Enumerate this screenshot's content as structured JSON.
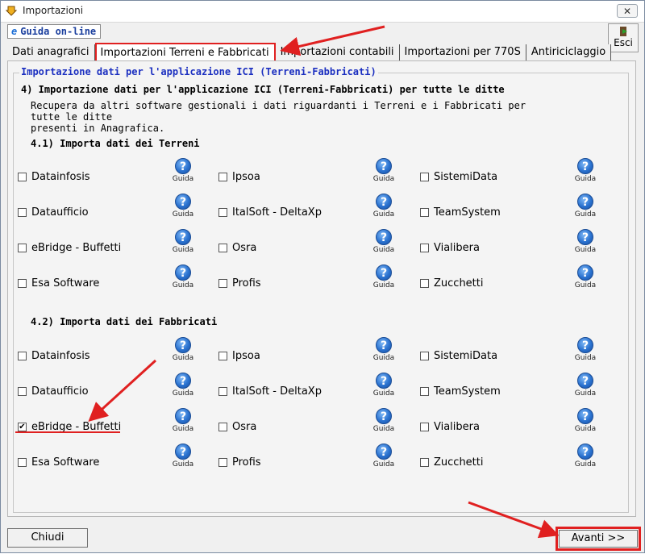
{
  "window": {
    "title": "Importazioni",
    "close_label": "✕"
  },
  "toolbar": {
    "guida_online": "Guida on-line",
    "esci_label": "Esci"
  },
  "tabs": [
    {
      "label": "Dati anagrafici",
      "active": false
    },
    {
      "label": "Importazioni Terreni e Fabbricati",
      "active": true
    },
    {
      "label": "Importazioni contabili",
      "active": false
    },
    {
      "label": "Importazioni per 770S",
      "active": false
    },
    {
      "label": "Antiriciclaggio",
      "active": false
    }
  ],
  "panel": {
    "group_title": "Importazione dati per l'applicazione ICI (Terreni-Fabbricati)",
    "heading": "4) Importazione dati per l'applicazione ICI (Terreni-Fabbricati) per tutte le ditte",
    "description_line1": "Recupera da altri software gestionali i dati riguardanti i Terreni e i Fabbricati per tutte le ditte",
    "description_line2": "presenti in Anagrafica.",
    "help_label": "Guida",
    "help_glyph": "?",
    "section_terreni": {
      "title": "4.1) Importa dati dei Terreni",
      "col1": [
        {
          "label": "Datainfosis",
          "checked": false
        },
        {
          "label": "Dataufficio",
          "checked": false
        },
        {
          "label": "eBridge - Buffetti",
          "checked": false
        },
        {
          "label": "Esa Software",
          "checked": false
        }
      ],
      "col2": [
        {
          "label": "Ipsoa",
          "checked": false
        },
        {
          "label": "ItalSoft - DeltaXp",
          "checked": false
        },
        {
          "label": "Osra",
          "checked": false
        },
        {
          "label": "Profis",
          "checked": false
        }
      ],
      "col3": [
        {
          "label": "SistemiData",
          "checked": false
        },
        {
          "label": "TeamSystem",
          "checked": false
        },
        {
          "label": "Vialibera",
          "checked": false
        },
        {
          "label": "Zucchetti",
          "checked": false
        }
      ]
    },
    "section_fabbricati": {
      "title": "4.2) Importa dati dei Fabbricati",
      "col1": [
        {
          "label": "Datainfosis",
          "checked": false
        },
        {
          "label": "Dataufficio",
          "checked": false
        },
        {
          "label": "eBridge - Buffetti",
          "checked": true
        },
        {
          "label": "Esa Software",
          "checked": false
        }
      ],
      "col2": [
        {
          "label": "Ipsoa",
          "checked": false
        },
        {
          "label": "ItalSoft - DeltaXp",
          "checked": false
        },
        {
          "label": "Osra",
          "checked": false
        },
        {
          "label": "Profis",
          "checked": false
        }
      ],
      "col3": [
        {
          "label": "SistemiData",
          "checked": false
        },
        {
          "label": "TeamSystem",
          "checked": false
        },
        {
          "label": "Vialibera",
          "checked": false
        },
        {
          "label": "Zucchetti",
          "checked": false
        }
      ]
    }
  },
  "footer": {
    "close_label": "Chiudi",
    "next_label": "Avanti >>"
  },
  "colors": {
    "highlight_red": "#e02020",
    "legend_blue": "#1b2fc0",
    "help_blue": "#2a72d0"
  }
}
